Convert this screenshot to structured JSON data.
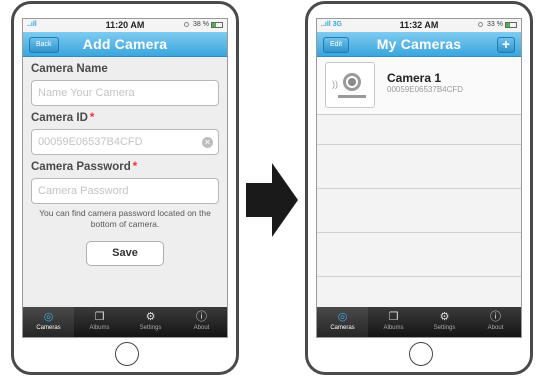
{
  "left_phone": {
    "status": {
      "signal": "..ıll",
      "time": "11:20 AM",
      "battery": "38 %"
    },
    "nav": {
      "back_label": "Back",
      "title": "Add Camera"
    },
    "form": {
      "camera_name_label": "Camera Name",
      "camera_name_placeholder": "Name Your Camera",
      "camera_id_label": "Camera ID",
      "camera_id_value": "00059E06537B4CFD",
      "camera_password_label": "Camera Password",
      "camera_password_placeholder": "Camera Password",
      "required_marker": "*",
      "hint": "You can find camera password located on the bottom of camera.",
      "save_label": "Save"
    },
    "tabs": [
      {
        "label": "Cameras",
        "icon": "camera-icon"
      },
      {
        "label": "Albums",
        "icon": "albums-icon"
      },
      {
        "label": "Settings",
        "icon": "settings-icon"
      },
      {
        "label": "About",
        "icon": "info-icon"
      }
    ]
  },
  "right_phone": {
    "status": {
      "signal": "..ıll 3G",
      "time": "11:32 AM",
      "battery": "33 %"
    },
    "nav": {
      "edit_label": "Edit",
      "title": "My Cameras",
      "add_label": "+"
    },
    "cameras": [
      {
        "name": "Camera 1",
        "id": "00059E06537B4CFD"
      }
    ],
    "tabs": [
      {
        "label": "Cameras",
        "icon": "camera-icon"
      },
      {
        "label": "Albums",
        "icon": "albums-icon"
      },
      {
        "label": "Settings",
        "icon": "settings-icon"
      },
      {
        "label": "About",
        "icon": "info-icon"
      }
    ]
  },
  "colors": {
    "nav_blue": "#3aa6de",
    "required_red": "#e33333",
    "tabbar_dark": "#1a1a1a",
    "arrow": "#1a1a1a"
  }
}
